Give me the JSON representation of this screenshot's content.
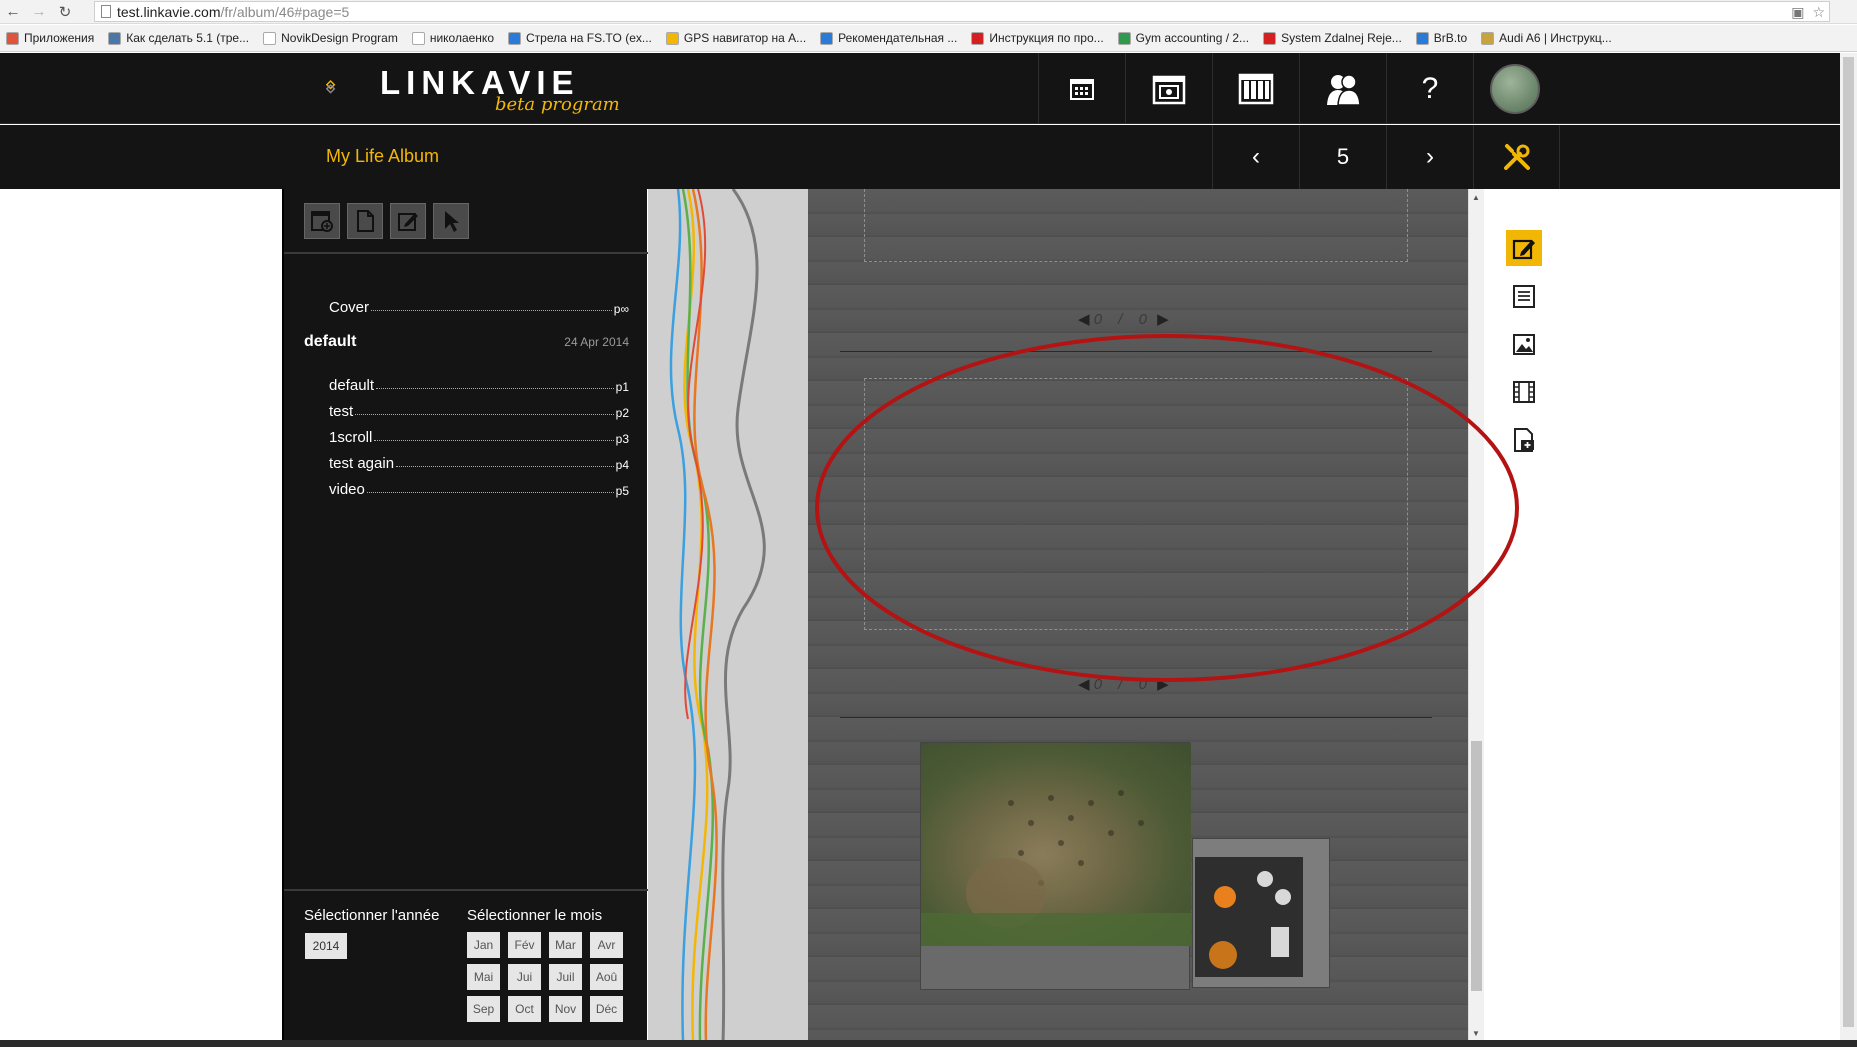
{
  "browser": {
    "url_host": "test.linkavie.com",
    "url_path": "/fr/album/46#page=5",
    "bookmarks": [
      {
        "label": "Приложения",
        "color": "#e0533d"
      },
      {
        "label": "Как сделать 5.1 (тре...",
        "color": "#4a76a8"
      },
      {
        "label": "NovikDesign Program",
        "color": "#ffffff"
      },
      {
        "label": "николаенко",
        "color": "#ffffff"
      },
      {
        "label": "Стрела на FS.TO (ex...",
        "color": "#2a7bd8"
      },
      {
        "label": "GPS навигатор на А...",
        "color": "#f2b705"
      },
      {
        "label": "Рекомендательная ...",
        "color": "#2a7bd8"
      },
      {
        "label": "Инструкция по про...",
        "color": "#d42020"
      },
      {
        "label": "Gym accounting / 2...",
        "color": "#2f9a4d"
      },
      {
        "label": "System Zdalnej Reje...",
        "color": "#d42020"
      },
      {
        "label": "BrB.to",
        "color": "#2a7bd8"
      },
      {
        "label": "Audi A6 | Инструкц...",
        "color": "#c8a23c"
      }
    ]
  },
  "app": {
    "logo_text": "LINKAVIE",
    "logo_sub": "beta program",
    "album_title": "My Life Album",
    "accent": "#f2b705",
    "top_icons": [
      "calendar-icon",
      "album-pages-icon",
      "grid-chart-icon",
      "friends-icon",
      "help-icon"
    ],
    "help_label": "?",
    "pager": {
      "prev": "‹",
      "page": "5",
      "next": "›"
    }
  },
  "sidebar": {
    "cover": {
      "label": "Cover",
      "page": "p∞"
    },
    "section": {
      "name": "default",
      "date": "24 Apr 2014"
    },
    "items": [
      {
        "label": "default",
        "page": "p1"
      },
      {
        "label": "test",
        "page": "p2"
      },
      {
        "label": "1scroll",
        "page": "p3"
      },
      {
        "label": "test again",
        "page": "p4"
      },
      {
        "label": "video",
        "page": "p5"
      }
    ],
    "year_label": "Sélectionner l'année",
    "month_label": "Sélectionner le mois",
    "year": "2014",
    "months": [
      "Jan",
      "Fév",
      "Mar",
      "Avr",
      "Mai",
      "Jui",
      "Juil",
      "Aoû",
      "Sep",
      "Oct",
      "Nov",
      "Déc"
    ]
  },
  "canvas": {
    "page_nav_1": "0 / 0",
    "page_nav_2": "0 / 0"
  }
}
